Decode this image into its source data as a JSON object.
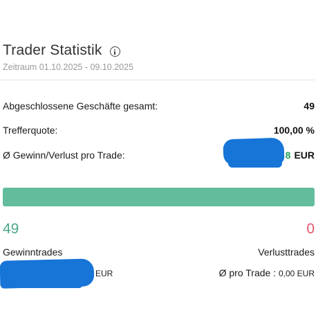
{
  "header": {
    "title": "Trader Statistik",
    "period": "Zeitraum 01.10.2025 - 09.10.2025"
  },
  "stats": {
    "closed_label": "Abgeschlossene Geschäfte gesamt:",
    "closed_value": "49",
    "hit_label": "Trefferquote:",
    "hit_value": "100,00 %",
    "avg_label": "Ø Gewinn/Verlust pro Trade:",
    "avg_value_visible": "8",
    "avg_unit": "EUR"
  },
  "bar": {
    "win_fraction": 1.0,
    "colors": {
      "win": "#63bd9c",
      "track": "#e6e6e6"
    }
  },
  "summary": {
    "win_count": "49",
    "loss_count": "0",
    "win_label": "Gewinntrades",
    "loss_label": "Verlusttrades",
    "win_avg_unit": "EUR",
    "loss_avg_label": "Ø pro Trade :",
    "loss_avg_value": "0,00 EUR"
  },
  "colors": {
    "gain_green": "#1e9e55",
    "win_count": "#4aa888",
    "loss_count": "#e2566b",
    "redaction": "#1775d8"
  },
  "icons": {
    "title_info": "info-circle-icon"
  }
}
